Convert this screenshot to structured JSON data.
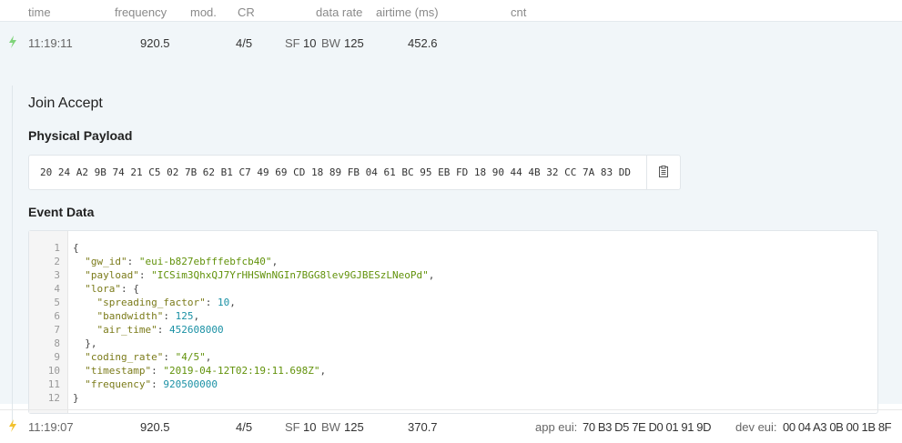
{
  "header": {
    "time": "time",
    "frequency": "frequency",
    "mod": "mod.",
    "cr": "CR",
    "data_rate": "data rate",
    "airtime": "airtime (ms)",
    "cnt": "cnt"
  },
  "rows": [
    {
      "time": "11:19:11",
      "frequency": "920.5",
      "cr": "4/5",
      "sf": "SF",
      "sf_value": "10",
      "bw": "BW",
      "bw_value": "125",
      "airtime": "452.6"
    },
    {
      "time": "11:19:07",
      "frequency": "920.5",
      "cr": "4/5",
      "sf": "SF",
      "sf_value": "10",
      "bw": "BW",
      "bw_value": "125",
      "airtime": "370.7",
      "app_eui_label": "app eui:",
      "app_eui": "70 B3 D5 7E D0 01 91 9D",
      "dev_eui_label": "dev eui:",
      "dev_eui": "00 04 A3 0B 00 1B 8F"
    }
  ],
  "detail": {
    "title": "Join Accept",
    "payload_heading": "Physical Payload",
    "payload_hex": "20 24 A2 9B 74 21 C5 02 7B 62 B1 C7 49 69 CD 18 89 FB 04 61 BC 95 EB FD 18 90 44 4B 32 CC 7A 83 DD",
    "event_heading": "Event Data",
    "line_numbers": [
      "1",
      "2",
      "3",
      "4",
      "5",
      "6",
      "7",
      "8",
      "9",
      "10",
      "11",
      "12"
    ],
    "json": {
      "open": "{",
      "close": "}",
      "gw_id_key": "\"gw_id\"",
      "gw_id_val": "\"eui-b827ebfffebfcb40\"",
      "payload_key": "\"payload\"",
      "payload_val": "\"ICSim3QhxQJ7YrHHSWnNGIn7BGG8lev9GJBESzLNeoPd\"",
      "lora_key": "\"lora\"",
      "lora_open": "{",
      "sf_key": "\"spreading_factor\"",
      "sf_val": "10",
      "bw_key": "\"bandwidth\"",
      "bw_val": "125",
      "air_key": "\"air_time\"",
      "air_val": "452608000",
      "lora_close": "},",
      "cr_key": "\"coding_rate\"",
      "cr_val": "\"4/5\"",
      "ts_key": "\"timestamp\"",
      "ts_val": "\"2019-04-12T02:19:11.698Z\"",
      "freq_key": "\"frequency\"",
      "freq_val": "920500000"
    }
  },
  "colors": {
    "uplink_bolt": "#7fd47a",
    "downlink_bolt": "#f2c12e",
    "panel_bg": "#f1f6f9"
  }
}
